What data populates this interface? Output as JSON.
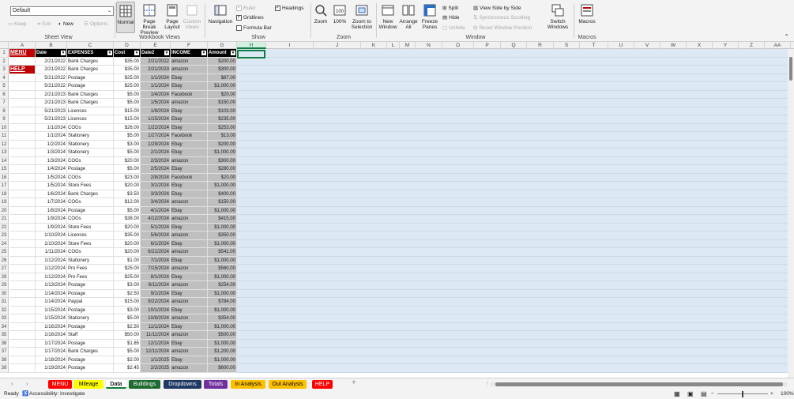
{
  "ribbon": {
    "sheet_view": {
      "current": "Default",
      "keep": "Keep",
      "exit": "Exit",
      "new": "New",
      "options": "Options",
      "label": "Sheet View"
    },
    "workbook_views": {
      "normal": "Normal",
      "page_break": "Page Break Preview",
      "page_layout": "Page Layout",
      "custom": "Custom Views",
      "label": "Workbook Views"
    },
    "navigation": "Navigation",
    "show": {
      "ruler": "Ruler",
      "gridlines": "Gridlines",
      "formula_bar": "Formula Bar",
      "headings": "Headings",
      "label": "Show"
    },
    "zoom": {
      "zoom": "Zoom",
      "hundred": "100%",
      "to_selection": "Zoom to Selection",
      "label": "Zoom"
    },
    "window": {
      "new_window": "New Window",
      "arrange_all": "Arrange All",
      "freeze": "Freeze Panes",
      "split": "Split",
      "hide": "Hide",
      "unhide": "Unhide",
      "side_by_side": "View Side by Side",
      "sync_scroll": "Synchronous Scrolling",
      "reset_pos": "Reset Window Position",
      "switch": "Switch Windows",
      "label": "Window"
    },
    "macros": {
      "macros": "Macros",
      "label": "Macros"
    }
  },
  "columns": [
    "A",
    "B",
    "C",
    "D",
    "E",
    "F",
    "G",
    "H",
    "I",
    "J",
    "K",
    "L",
    "M",
    "N",
    "O",
    "P",
    "Q",
    "R",
    "S",
    "T",
    "U",
    "V",
    "W",
    "X",
    "Y",
    "Z",
    "AA"
  ],
  "header_row": {
    "date": "Date",
    "expenses": "EXPENSES",
    "cost": "Cost",
    "date2": "Date2",
    "income": "INCOME",
    "amount": "Amount"
  },
  "buttons": {
    "menu": "MENU",
    "help": "HELP"
  },
  "rows": [
    [
      "2/21/2022",
      "Bank Charges",
      "$35.00",
      "2/21/2022",
      "amazon",
      "$200.00"
    ],
    [
      "2/21/2022",
      "Bank Charges",
      "$35.00",
      "2/21/2023",
      "amazon",
      "$300.00"
    ],
    [
      "5/21/2022",
      "Postage",
      "$25.00",
      "1/1/2024",
      "Ebay",
      "$87.00"
    ],
    [
      "5/21/2022",
      "Postage",
      "$25.00",
      "1/1/2024",
      "Ebay",
      "$1,000.00"
    ],
    [
      "2/21/2023",
      "Bank Charges",
      "$5.00",
      "1/4/2024",
      "Facebook",
      "$20.00"
    ],
    [
      "2/21/2023",
      "Bank Charges",
      "$5.00",
      "1/5/2024",
      "amazon",
      "$150.00"
    ],
    [
      "5/21/2023",
      "Licences",
      "$15.00",
      "1/8/2024",
      "Ebay",
      "$103.00"
    ],
    [
      "5/21/2023",
      "Licences",
      "$15.00",
      "1/15/2024",
      "Ebay",
      "$235.00"
    ],
    [
      "1/1/2024",
      "COGs",
      "$26.00",
      "1/22/2024",
      "Ebay",
      "$253.00"
    ],
    [
      "1/1/2024",
      "Stationery",
      "$5.00",
      "1/27/2024",
      "Facebook",
      "$13.00"
    ],
    [
      "1/2/2024",
      "Stationery",
      "$3.00",
      "1/29/2024",
      "Ebay",
      "$200.00"
    ],
    [
      "1/3/2024",
      "Stationery",
      "$5.00",
      "2/1/2024",
      "Ebay",
      "$1,000.00"
    ],
    [
      "1/3/2024",
      "COGs",
      "$20.00",
      "2/3/2024",
      "amazon",
      "$300.00"
    ],
    [
      "1/4/2024",
      "Postage",
      "$5.00",
      "2/5/2024",
      "Ebay",
      "$280.00"
    ],
    [
      "1/5/2024",
      "COGs",
      "$23.00",
      "2/8/2024",
      "Facebook",
      "$20.00"
    ],
    [
      "1/5/2024",
      "Store Fees",
      "$20.00",
      "3/1/2024",
      "Ebay",
      "$1,000.00"
    ],
    [
      "1/6/2024",
      "Bank Charges",
      "$3.50",
      "3/3/2024",
      "Ebay",
      "$400.00"
    ],
    [
      "1/7/2024",
      "COGs",
      "$12.00",
      "3/4/2024",
      "amazon",
      "$150.00"
    ],
    [
      "1/8/2024",
      "Postage",
      "$5.00",
      "4/1/2024",
      "Ebay",
      "$1,000.00"
    ],
    [
      "1/9/2024",
      "COGs",
      "$38.00",
      "4/12/2024",
      "amazon",
      "$415.00"
    ],
    [
      "1/9/2024",
      "Store Fees",
      "$20.00",
      "5/1/2024",
      "Ebay",
      "$1,000.00"
    ],
    [
      "1/10/2024",
      "Licences",
      "$35.00",
      "5/6/2024",
      "amazon",
      "$350.00"
    ],
    [
      "1/10/2024",
      "Store Fees",
      "$20.00",
      "6/1/2024",
      "Ebay",
      "$1,000.00"
    ],
    [
      "1/11/2024",
      "COGs",
      "$20.00",
      "6/21/2024",
      "amazon",
      "$541.00"
    ],
    [
      "1/12/2024",
      "Stationery",
      "$1.00",
      "7/1/2024",
      "Ebay",
      "$1,000.00"
    ],
    [
      "1/12/2024",
      "Pro Fees",
      "$25.00",
      "7/15/2024",
      "amazon",
      "$560.00"
    ],
    [
      "1/12/2024",
      "Pro Fees",
      "$25.00",
      "8/1/2024",
      "Ebay",
      "$1,000.00"
    ],
    [
      "1/13/2024",
      "Postage",
      "$3.00",
      "8/11/2024",
      "amazon",
      "$254.00"
    ],
    [
      "1/14/2024",
      "Postage",
      "$2.50",
      "9/1/2024",
      "Ebay",
      "$1,000.00"
    ],
    [
      "1/14/2024",
      "Paypal",
      "$15.00",
      "9/22/2024",
      "amazon",
      "$784.00"
    ],
    [
      "1/15/2024",
      "Postage",
      "$3.00",
      "10/1/2024",
      "Ebay",
      "$1,000.00"
    ],
    [
      "1/15/2024",
      "Stationery",
      "$5.00",
      "10/8/2024",
      "amazon",
      "$354.00"
    ],
    [
      "1/16/2024",
      "Postage",
      "$2.50",
      "11/1/2024",
      "Ebay",
      "$1,000.00"
    ],
    [
      "1/16/2024",
      "Staff",
      "$50.00",
      "11/11/2024",
      "amazon",
      "$500.00"
    ],
    [
      "1/17/2024",
      "Postage",
      "$1.85",
      "12/1/2024",
      "Ebay",
      "$1,000.00"
    ],
    [
      "1/17/2024",
      "Bank Charges",
      "$5.00",
      "12/11/2024",
      "amazon",
      "$1,200.00"
    ],
    [
      "1/18/2024",
      "Postage",
      "$2.00",
      "1/1/2025",
      "Ebay",
      "$1,000.00"
    ],
    [
      "1/19/2024",
      "Postage",
      "$2.45",
      "2/2/2025",
      "amazon",
      "$600.00"
    ]
  ],
  "tabs": [
    {
      "label": "MENU",
      "bg": "#ff0000",
      "fg": "#ffffff"
    },
    {
      "label": "Mileage",
      "bg": "#ffff00",
      "fg": "#000000"
    },
    {
      "label": "Data",
      "bg": "#ffffff",
      "fg": "#107c41"
    },
    {
      "label": "Buildings",
      "bg": "#1e6b30",
      "fg": "#ffffff"
    },
    {
      "label": "Dropdowns",
      "bg": "#1f3864",
      "fg": "#ffffff"
    },
    {
      "label": "Totals",
      "bg": "#7030a0",
      "fg": "#ffffff"
    },
    {
      "label": "In Analysis",
      "bg": "#ffc000",
      "fg": "#000000"
    },
    {
      "label": "Out Analysis",
      "bg": "#ffc000",
      "fg": "#000000"
    },
    {
      "label": "HELP",
      "bg": "#ff0000",
      "fg": "#ffffff"
    }
  ],
  "status": {
    "ready": "Ready",
    "accessibility": "Accessibility: Investigate",
    "zoom": "100%"
  }
}
